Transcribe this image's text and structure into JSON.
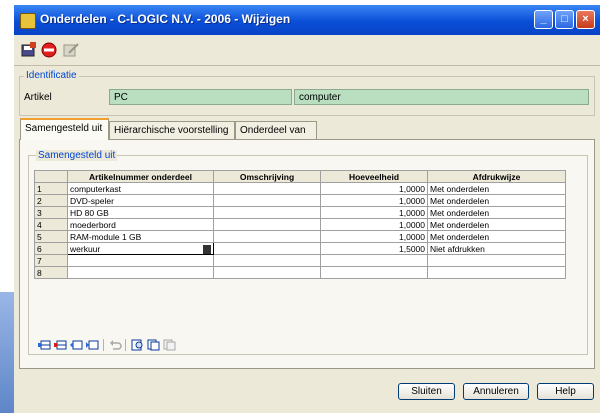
{
  "window": {
    "title": "Onderdelen - C-LOGIC N.V. - 2006 - Wijzigen",
    "controls": {
      "minimize": "_",
      "maximize": "□",
      "close": "×"
    }
  },
  "toolbar": {
    "icons": [
      "save-icon",
      "stop-icon",
      "edit-icon"
    ]
  },
  "identificatie": {
    "legend": "Identificatie",
    "artikel_label": "Artikel",
    "artikel_code": "PC",
    "artikel_omschrijving": "computer"
  },
  "tabs": [
    {
      "label": "Samengesteld uit",
      "active": true
    },
    {
      "label": "Hiërarchische voorstelling",
      "active": false
    },
    {
      "label": "Onderdeel van",
      "active": false
    }
  ],
  "samengesteld": {
    "legend": "Samengesteld uit",
    "columns": [
      "Artikelnummer onderdeel",
      "Omschrijving",
      "Hoeveelheid",
      "Afdrukwijze"
    ],
    "rows": [
      {
        "n": "1",
        "artikel": "computerkast",
        "omschrijving": "",
        "hoeveelheid": "1,0000",
        "afdrukwijze": "Met onderdelen"
      },
      {
        "n": "2",
        "artikel": "DVD-speler",
        "omschrijving": "",
        "hoeveelheid": "1,0000",
        "afdrukwijze": "Met onderdelen"
      },
      {
        "n": "3",
        "artikel": "HD 80 GB",
        "omschrijving": "",
        "hoeveelheid": "1,0000",
        "afdrukwijze": "Met onderdelen"
      },
      {
        "n": "4",
        "artikel": "moederbord",
        "omschrijving": "",
        "hoeveelheid": "1,0000",
        "afdrukwijze": "Met onderdelen"
      },
      {
        "n": "5",
        "artikel": "RAM-module 1 GB",
        "omschrijving": "",
        "hoeveelheid": "1,0000",
        "afdrukwijze": "Met onderdelen"
      },
      {
        "n": "6",
        "artikel": "werkuur",
        "omschrijving": "",
        "hoeveelheid": "1,5000",
        "afdrukwijze": "Niet afdrukken"
      },
      {
        "n": "7",
        "artikel": "",
        "omschrijving": "",
        "hoeveelheid": "",
        "afdrukwijze": ""
      },
      {
        "n": "8",
        "artikel": "",
        "omschrijving": "",
        "hoeveelheid": "",
        "afdrukwijze": ""
      }
    ],
    "grid_icons": [
      "insert-row-icon",
      "delete-row-icon",
      "move-up-icon",
      "move-down-icon",
      "undo-icon",
      "find-icon",
      "copy-icon",
      "paste-icon"
    ]
  },
  "buttons": {
    "sluiten": "Sluiten",
    "annuleren": "Annuleren",
    "help": "Help"
  },
  "colors": {
    "field_bg": "#b9dfc0",
    "titlebar": "#0a4fd8",
    "legend": "#0046d5"
  }
}
